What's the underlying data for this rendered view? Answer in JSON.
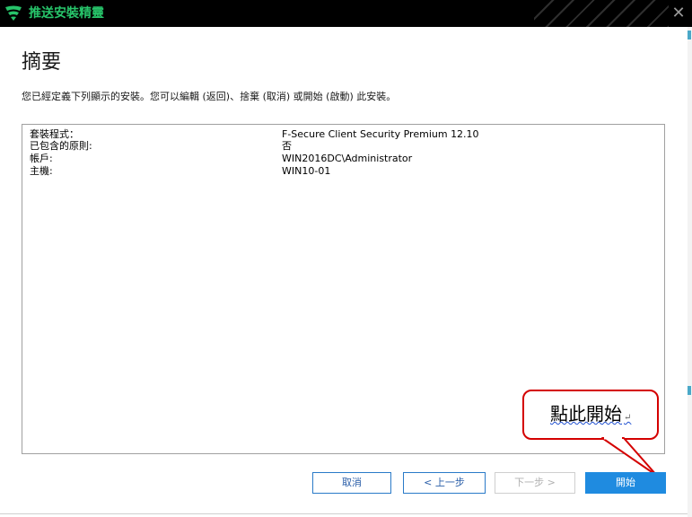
{
  "window": {
    "title": "推送安裝精靈",
    "close_glyph": "✕"
  },
  "page": {
    "heading": "摘要",
    "description": "您已經定義下列顯示的安裝。您可以編輯 (返回)、捨棄 (取消) 或開始 (啟動) 此安裝。"
  },
  "summary": {
    "rows": [
      {
        "key": "套裝程式：",
        "value": "F-Secure Client Security Premium 12.10"
      },
      {
        "key": "已包含的原則:",
        "value": "否"
      },
      {
        "key": "帳戶:",
        "value": "WIN2016DC\\Administrator"
      },
      {
        "key": "主機:",
        "value": "WIN10-01"
      }
    ]
  },
  "buttons": {
    "cancel": "取消",
    "back": "< 上一步",
    "next": "下一步 >",
    "start": "開始"
  },
  "callout": {
    "text": "點此開始",
    "mark": "↵"
  },
  "colors": {
    "accent": "#1f8be0",
    "brand_green": "#27c46a",
    "callout_red": "#d40000"
  },
  "icons": {
    "app": "f-secure-shield-icon",
    "close": "close-icon"
  }
}
